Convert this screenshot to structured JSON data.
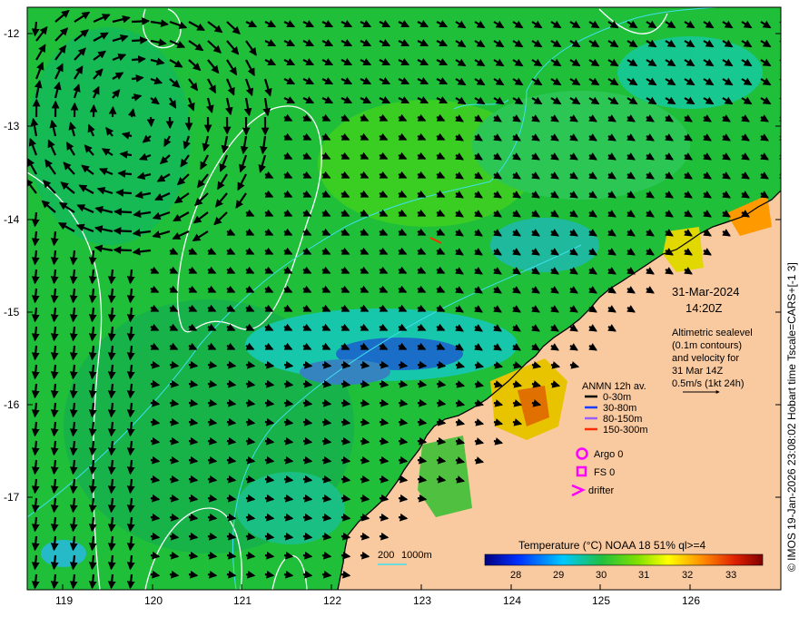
{
  "map": {
    "lon_ticks": [
      "119",
      "120",
      "121",
      "122",
      "123",
      "124",
      "125",
      "126"
    ],
    "lat_ticks": [
      "-12",
      "-13",
      "-14",
      "-15",
      "-16",
      "-17"
    ],
    "date": "31-Mar-2024",
    "time": "14:20Z",
    "altimetry_lines": [
      "Altimetric sealevel",
      "(0.1m contours)",
      "and velocity for",
      "31 Mar 14Z",
      "0.5m/s (1kt 24h)"
    ],
    "anmn_title": "ANMN 12h av.",
    "anmn_items": [
      {
        "label": "0-30m",
        "color": "#000000"
      },
      {
        "label": "30-80m",
        "color": "#1a3cff"
      },
      {
        "label": "80-150m",
        "color": "#9a60ff"
      },
      {
        "label": "150-300m",
        "color": "#ff2a00"
      }
    ],
    "argo_label": "Argo 0",
    "fs_label": "FS 0",
    "drifter_label": "drifter",
    "depth_labels": [
      "200",
      "1000m"
    ],
    "colorbar_title": "Temperature (°C) NOAA 18 51% ql>=4",
    "colorbar_ticks": [
      "28",
      "29",
      "30",
      "31",
      "32",
      "33"
    ],
    "credit": "© IMOS 19-Jan-2026 23:08:02 Hobart time Tscale=CARS+[-1 3]",
    "colors": {
      "land": "#f9c9a0",
      "sea": "#1fbf3a",
      "marker": "#ff00ff"
    }
  }
}
